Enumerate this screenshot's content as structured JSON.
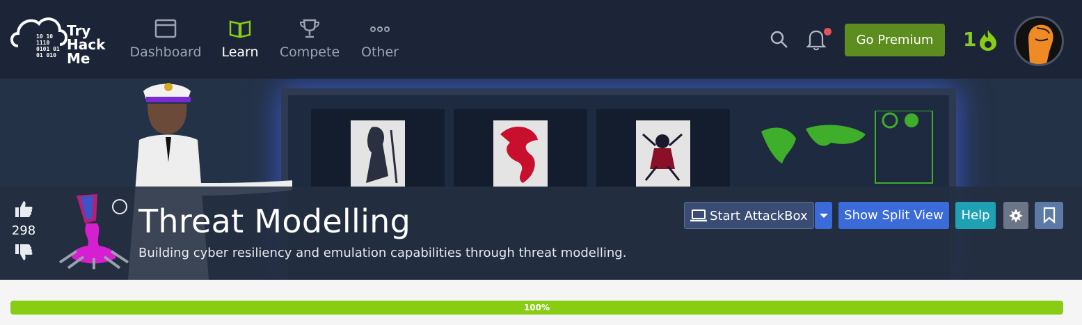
{
  "nav": {
    "logo_lines": [
      "Try",
      "Hack",
      "Me"
    ],
    "logo_binary": [
      "10  10",
      "1110",
      "0101 01",
      "01 010"
    ],
    "items": [
      {
        "label": "Dashboard",
        "icon": "dashboard-icon",
        "active": false
      },
      {
        "label": "Learn",
        "icon": "book-icon",
        "active": true
      },
      {
        "label": "Compete",
        "icon": "trophy-icon",
        "active": false
      },
      {
        "label": "Other",
        "icon": "more-dots-icon",
        "active": false
      }
    ],
    "premium_label": "Go Premium",
    "streak_count": "1",
    "notifications_dot": true
  },
  "room": {
    "title": "Threat Modelling",
    "subtitle": "Building cyber resiliency and emulation capabilities through threat modelling.",
    "votes": "298"
  },
  "actions": {
    "attackbox_label": "Start AttackBox",
    "split_label": "Show Split View",
    "help_label": "Help"
  },
  "progress": {
    "percent": 100,
    "label": "100%"
  },
  "colors": {
    "nav_bg": "#1c2538",
    "accent_green": "#88cc14",
    "premium_green": "#5e8d1f",
    "split_blue": "#3a6bd9",
    "help_teal": "#1fa1b3"
  }
}
